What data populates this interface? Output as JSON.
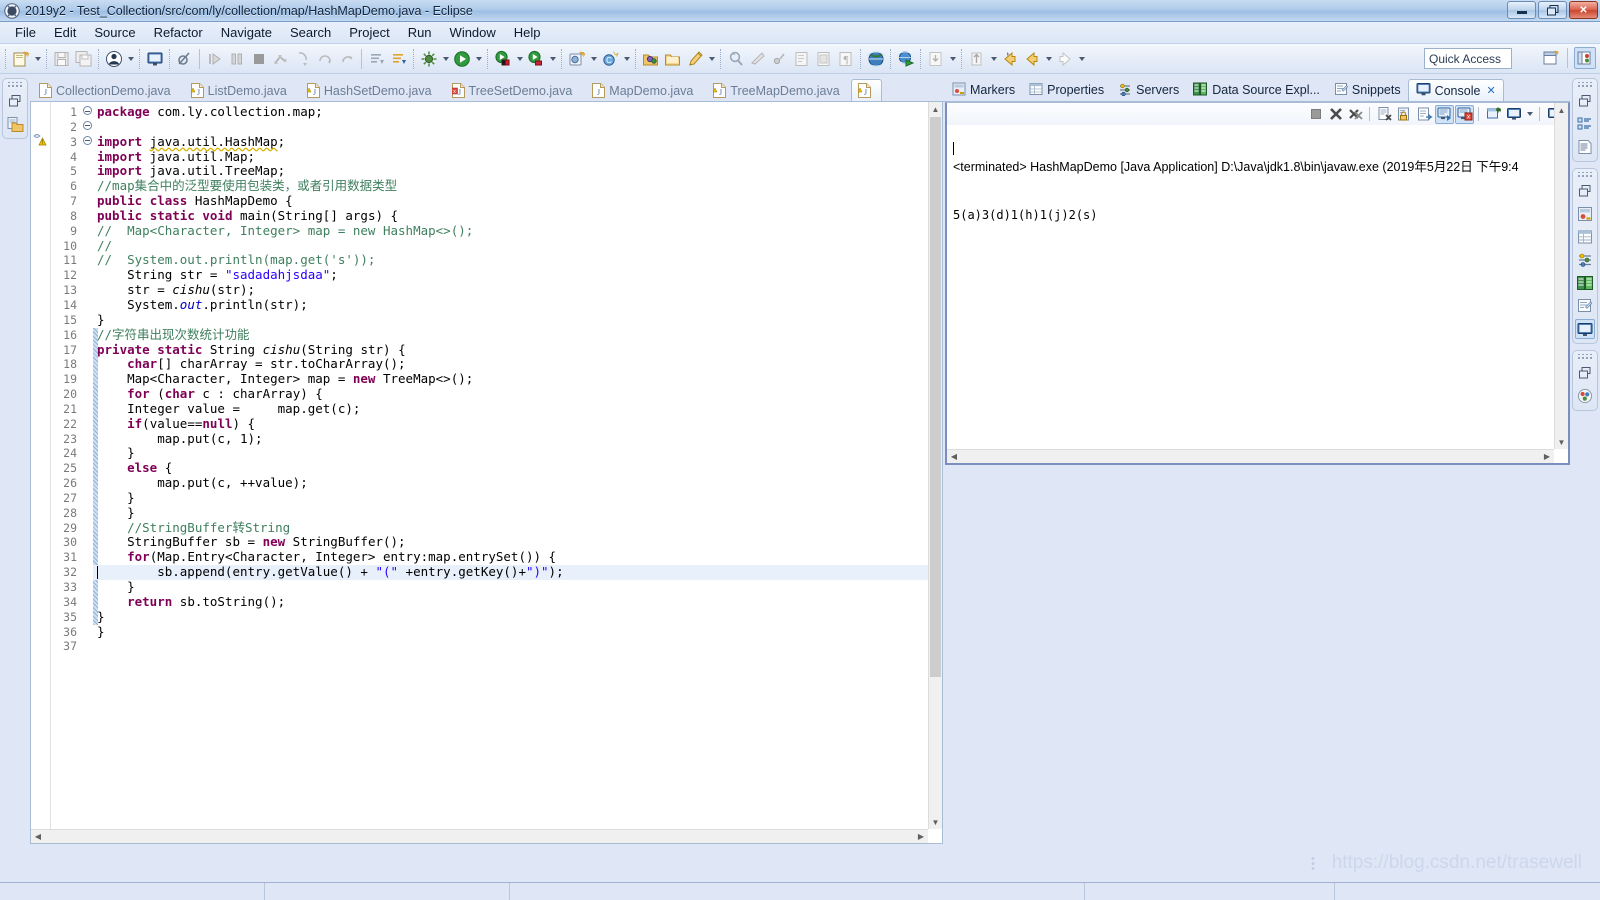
{
  "window": {
    "title": "2019y2 - Test_Collection/src/com/ly/collection/map/HashMapDemo.java - Eclipse",
    "app_icon": "eclipse-icon",
    "minimize_label": "Minimize",
    "restore_label": "Restore",
    "close_label": "Close"
  },
  "menubar": {
    "items": [
      {
        "label": "File"
      },
      {
        "label": "Edit"
      },
      {
        "label": "Source"
      },
      {
        "label": "Refactor"
      },
      {
        "label": "Navigate"
      },
      {
        "label": "Search"
      },
      {
        "label": "Project"
      },
      {
        "label": "Run"
      },
      {
        "label": "Window"
      },
      {
        "label": "Help"
      }
    ]
  },
  "toolbar": {
    "quick_access_placeholder": "Quick Access",
    "quick_access_value": "Quick Access",
    "groups": [
      {
        "buttons": [
          {
            "name": "new-wizard-icon",
            "glyph": "new"
          },
          {
            "name": "dropdown-arrow-new",
            "glyph": "arrow"
          }
        ]
      },
      {
        "buttons": [
          {
            "name": "save-icon",
            "glyph": "save"
          },
          {
            "name": "save-all-icon",
            "glyph": "saveall"
          }
        ]
      },
      {
        "buttons": [
          {
            "name": "user-profile-icon",
            "glyph": "user"
          },
          {
            "name": "dropdown-arrow-user",
            "glyph": "arrow"
          }
        ]
      },
      {
        "buttons": [
          {
            "name": "open-console-icon",
            "glyph": "console"
          }
        ]
      },
      {
        "buttons": [
          {
            "name": "skip-breakpoints-icon",
            "glyph": "skipbp"
          }
        ]
      },
      {
        "buttons": [
          {
            "name": "resume-icon",
            "glyph": "resume"
          },
          {
            "name": "suspend-icon",
            "glyph": "suspend"
          },
          {
            "name": "terminate-icon",
            "glyph": "terminate"
          },
          {
            "name": "disconnect-icon",
            "glyph": "disconnect"
          },
          {
            "name": "step-into-icon",
            "glyph": "stepinto"
          },
          {
            "name": "step-over-icon",
            "glyph": "stepover"
          },
          {
            "name": "step-return-icon",
            "glyph": "stepreturn"
          }
        ]
      },
      {
        "buttons": [
          {
            "name": "next-annotation-icon",
            "glyph": "nextann"
          },
          {
            "name": "previous-annotation-icon",
            "glyph": "prevann"
          }
        ]
      },
      {
        "buttons": [
          {
            "name": "debug-icon",
            "glyph": "debug"
          },
          {
            "name": "dropdown-arrow-debug",
            "glyph": "arrow"
          },
          {
            "name": "run-icon",
            "glyph": "run"
          },
          {
            "name": "dropdown-arrow-run",
            "glyph": "arrow"
          }
        ]
      },
      {
        "buttons": [
          {
            "name": "run-as-server-icon",
            "glyph": "runserver"
          },
          {
            "name": "dropdown-arrow-runserver",
            "glyph": "arrow"
          },
          {
            "name": "run-external-tools-icon",
            "glyph": "exttools"
          },
          {
            "name": "dropdown-arrow-exttools",
            "glyph": "arrow"
          }
        ]
      },
      {
        "buttons": [
          {
            "name": "new-java-project-icon",
            "glyph": "newproj"
          },
          {
            "name": "dropdown-arrow-newproj",
            "glyph": "arrow"
          },
          {
            "name": "new-class-icon",
            "glyph": "newclass"
          },
          {
            "name": "dropdown-arrow-newclass",
            "glyph": "arrow"
          }
        ]
      },
      {
        "buttons": [
          {
            "name": "open-type-icon",
            "glyph": "opentype"
          },
          {
            "name": "open-task-icon",
            "glyph": "opentask"
          },
          {
            "name": "quick-fix-icon",
            "glyph": "quickfix"
          },
          {
            "name": "dropdown-arrow-quickfix",
            "glyph": "arrow"
          }
        ]
      },
      {
        "buttons": [
          {
            "name": "search-icon",
            "glyph": "search"
          },
          {
            "name": "link-editor-icon",
            "glyph": "linkeditor"
          },
          {
            "name": "toggle-mark-occurrences-icon",
            "glyph": "markocc"
          },
          {
            "name": "show-whitespace-icon",
            "glyph": "whitespace"
          },
          {
            "name": "block-selection-icon",
            "glyph": "blocksel"
          },
          {
            "name": "pilcrow-icon",
            "glyph": "pilcrow"
          }
        ]
      },
      {
        "buttons": [
          {
            "name": "open-web-browser-icon",
            "glyph": "browser"
          }
        ]
      },
      {
        "buttons": [
          {
            "name": "run-on-server-icon",
            "glyph": "runonserver"
          }
        ]
      },
      {
        "buttons": [
          {
            "name": "download-icon",
            "glyph": "download"
          },
          {
            "name": "dropdown-arrow-download",
            "glyph": "arrow"
          }
        ]
      },
      {
        "buttons": [
          {
            "name": "back-history-icon",
            "glyph": "backhist"
          },
          {
            "name": "dropdown-arrow-backhist",
            "glyph": "arrow"
          },
          {
            "name": "back-icon",
            "glyph": "back"
          },
          {
            "name": "dropdown-arrow-back",
            "glyph": "arrow"
          },
          {
            "name": "forward-icon",
            "glyph": "forward"
          },
          {
            "name": "dropdown-arrow-forward",
            "glyph": "arrow"
          }
        ]
      }
    ],
    "perspective_buttons": [
      {
        "name": "open-perspective-icon"
      },
      {
        "name": "java-ee-perspective-icon"
      }
    ]
  },
  "left_rail": {
    "stacks": [
      {
        "grip": "restore-grip",
        "icons": [
          {
            "name": "restore-icon"
          },
          {
            "name": "project-explorer-icon"
          }
        ]
      }
    ]
  },
  "right_rail": {
    "stacks": [
      {
        "icons": [
          {
            "name": "restore-icon"
          },
          {
            "name": "outline-view-icon"
          },
          {
            "name": "task-list-icon"
          }
        ]
      },
      {
        "icons": [
          {
            "name": "restore-icon"
          },
          {
            "name": "markers-view-icon"
          },
          {
            "name": "properties-view-icon"
          },
          {
            "name": "servers-view-icon"
          },
          {
            "name": "data-source-explorer-icon"
          },
          {
            "name": "snippets-view-icon"
          },
          {
            "name": "console-view-icon"
          }
        ]
      },
      {
        "icons": [
          {
            "name": "restore-icon"
          },
          {
            "name": "progress-view-icon"
          }
        ]
      }
    ]
  },
  "editor": {
    "tabs": [
      {
        "label": "CollectionDemo.java",
        "icon": "java-file-icon",
        "marker": "none",
        "active": false
      },
      {
        "label": "ListDemo.java",
        "icon": "java-file-icon",
        "marker": "warning",
        "active": false
      },
      {
        "label": "HashSetDemo.java",
        "icon": "java-file-icon",
        "marker": "warning",
        "active": false
      },
      {
        "label": "TreeSetDemo.java",
        "icon": "java-file-icon",
        "marker": "error",
        "active": false
      },
      {
        "label": "MapDemo.java",
        "icon": "java-file-icon",
        "marker": "none",
        "active": false
      },
      {
        "label": "TreeMapDemo.java",
        "icon": "java-file-icon",
        "marker": "warning",
        "active": false
      },
      {
        "label": "",
        "icon": "java-file-icon",
        "marker": "warning",
        "active": true
      }
    ],
    "highlighted_line": 32,
    "caret_line": 32,
    "lines": [
      {
        "n": 1,
        "fold": "",
        "marker": "",
        "code": "package com.ly.collection.map;"
      },
      {
        "n": 2,
        "fold": "",
        "marker": "",
        "code": ""
      },
      {
        "n": 3,
        "fold": "-",
        "marker": "warning",
        "code": "import java.util.HashMap;"
      },
      {
        "n": 4,
        "fold": "",
        "marker": "",
        "code": "import java.util.Map;"
      },
      {
        "n": 5,
        "fold": "",
        "marker": "",
        "code": "import java.util.TreeMap;"
      },
      {
        "n": 6,
        "fold": "",
        "marker": "",
        "code": "//map集合中的泛型要使用包装类，或者引用数据类型"
      },
      {
        "n": 7,
        "fold": "",
        "marker": "",
        "code": "public class HashMapDemo {"
      },
      {
        "n": 8,
        "fold": "-",
        "marker": "",
        "code": "public static void main(String[] args) {"
      },
      {
        "n": 9,
        "fold": "",
        "marker": "",
        "code": "//  Map<Character, Integer> map = new HashMap<>();"
      },
      {
        "n": 10,
        "fold": "",
        "marker": "",
        "code": "//"
      },
      {
        "n": 11,
        "fold": "",
        "marker": "",
        "code": "//  System.out.println(map.get('s'));"
      },
      {
        "n": 12,
        "fold": "",
        "marker": "",
        "code": "    String str = \"sadadahjsdaa\";"
      },
      {
        "n": 13,
        "fold": "",
        "marker": "",
        "code": "    str = cishu(str);"
      },
      {
        "n": 14,
        "fold": "",
        "marker": "",
        "code": "    System.out.println(str);"
      },
      {
        "n": 15,
        "fold": "",
        "marker": "",
        "code": "}"
      },
      {
        "n": 16,
        "fold": "",
        "marker": "",
        "code": "//字符串出现次数统计功能"
      },
      {
        "n": 17,
        "fold": "-",
        "marker": "",
        "code": "private static String cishu(String str) {"
      },
      {
        "n": 18,
        "fold": "",
        "marker": "",
        "code": "    char[] charArray = str.toCharArray();"
      },
      {
        "n": 19,
        "fold": "",
        "marker": "",
        "code": "    Map<Character, Integer> map = new TreeMap<>();"
      },
      {
        "n": 20,
        "fold": "",
        "marker": "",
        "code": "    for (char c : charArray) {"
      },
      {
        "n": 21,
        "fold": "",
        "marker": "",
        "code": "    Integer value =     map.get(c);"
      },
      {
        "n": 22,
        "fold": "",
        "marker": "",
        "code": "    if(value==null) {"
      },
      {
        "n": 23,
        "fold": "",
        "marker": "",
        "code": "        map.put(c, 1);"
      },
      {
        "n": 24,
        "fold": "",
        "marker": "",
        "code": "    }"
      },
      {
        "n": 25,
        "fold": "",
        "marker": "",
        "code": "    else {"
      },
      {
        "n": 26,
        "fold": "",
        "marker": "",
        "code": "        map.put(c, ++value);"
      },
      {
        "n": 27,
        "fold": "",
        "marker": "",
        "code": "    }"
      },
      {
        "n": 28,
        "fold": "",
        "marker": "",
        "code": "    }"
      },
      {
        "n": 29,
        "fold": "",
        "marker": "",
        "code": "    //StringBuffer转String"
      },
      {
        "n": 30,
        "fold": "",
        "marker": "",
        "code": "    StringBuffer sb = new StringBuffer();"
      },
      {
        "n": 31,
        "fold": "",
        "marker": "",
        "code": "    for(Map.Entry<Character, Integer> entry:map.entrySet()) {"
      },
      {
        "n": 32,
        "fold": "",
        "marker": "",
        "code": "        sb.append(entry.getValue() + \"(\" +entry.getKey()+\")\");"
      },
      {
        "n": 33,
        "fold": "",
        "marker": "",
        "code": "    }"
      },
      {
        "n": 34,
        "fold": "",
        "marker": "",
        "code": "    return sb.toString();"
      },
      {
        "n": 35,
        "fold": "",
        "marker": "",
        "code": "}"
      },
      {
        "n": 36,
        "fold": "",
        "marker": "",
        "code": "}"
      },
      {
        "n": 37,
        "fold": "",
        "marker": "",
        "code": ""
      }
    ]
  },
  "view_panel": {
    "tabs": [
      {
        "label": "Markers",
        "icon": "markers-icon",
        "active": false,
        "closable": false
      },
      {
        "label": "Properties",
        "icon": "properties-icon",
        "active": false,
        "closable": false
      },
      {
        "label": "Servers",
        "icon": "servers-icon",
        "active": false,
        "closable": false
      },
      {
        "label": "Data Source Expl...",
        "icon": "data-source-icon",
        "active": false,
        "closable": false
      },
      {
        "label": "Snippets",
        "icon": "snippets-icon",
        "active": false,
        "closable": false
      },
      {
        "label": "Console",
        "icon": "console-icon",
        "active": true,
        "closable": true,
        "close_glyph": "✕"
      }
    ],
    "console": {
      "toolbar_buttons": [
        {
          "name": "terminate-icon",
          "glyph": "stop",
          "pressed": false
        },
        {
          "name": "remove-launch-icon",
          "glyph": "x",
          "pressed": false
        },
        {
          "name": "remove-all-launches-icon",
          "glyph": "xx",
          "pressed": false
        },
        {
          "name": "clear-console-icon",
          "glyph": "clear",
          "pressed": false
        },
        {
          "name": "lock-scroll-icon",
          "glyph": "lock",
          "pressed": false
        },
        {
          "name": "word-wrap-icon",
          "glyph": "wrap",
          "pressed": false
        },
        {
          "name": "show-console-on-output-icon",
          "glyph": "showout",
          "pressed": true
        },
        {
          "name": "show-console-on-error-icon",
          "glyph": "showerr",
          "pressed": true
        },
        {
          "name": "pin-console-icon",
          "glyph": "pin",
          "pressed": false
        },
        {
          "name": "display-selected-console-icon",
          "glyph": "display",
          "pressed": false
        },
        {
          "name": "dropdown-arrow-console",
          "glyph": "arrow",
          "pressed": false
        },
        {
          "name": "open-console-icon",
          "glyph": "openconsole",
          "pressed": false
        }
      ],
      "status_line": "<terminated> HashMapDemo [Java Application] D:\\Java\\jdk1.8\\bin\\javaw.exe (2019年5月22日 下午9:4",
      "output": "5(a)3(d)1(h)1(j)2(s)"
    }
  },
  "footer": {
    "watermark": "https://blog.csdn.net/trasewell"
  }
}
